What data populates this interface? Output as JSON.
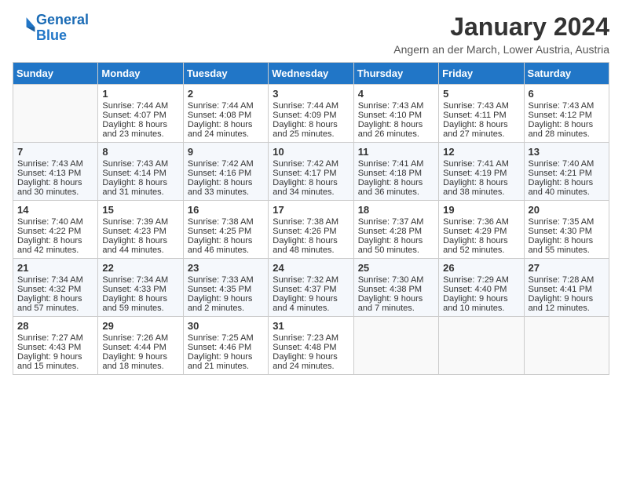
{
  "logo": {
    "line1": "General",
    "line2": "Blue"
  },
  "title": "January 2024",
  "subtitle": "Angern an der March, Lower Austria, Austria",
  "days_of_week": [
    "Sunday",
    "Monday",
    "Tuesday",
    "Wednesday",
    "Thursday",
    "Friday",
    "Saturday"
  ],
  "weeks": [
    [
      {
        "day": "",
        "sunrise": "",
        "sunset": "",
        "daylight": ""
      },
      {
        "day": "1",
        "sunrise": "Sunrise: 7:44 AM",
        "sunset": "Sunset: 4:07 PM",
        "daylight": "Daylight: 8 hours and 23 minutes."
      },
      {
        "day": "2",
        "sunrise": "Sunrise: 7:44 AM",
        "sunset": "Sunset: 4:08 PM",
        "daylight": "Daylight: 8 hours and 24 minutes."
      },
      {
        "day": "3",
        "sunrise": "Sunrise: 7:44 AM",
        "sunset": "Sunset: 4:09 PM",
        "daylight": "Daylight: 8 hours and 25 minutes."
      },
      {
        "day": "4",
        "sunrise": "Sunrise: 7:43 AM",
        "sunset": "Sunset: 4:10 PM",
        "daylight": "Daylight: 8 hours and 26 minutes."
      },
      {
        "day": "5",
        "sunrise": "Sunrise: 7:43 AM",
        "sunset": "Sunset: 4:11 PM",
        "daylight": "Daylight: 8 hours and 27 minutes."
      },
      {
        "day": "6",
        "sunrise": "Sunrise: 7:43 AM",
        "sunset": "Sunset: 4:12 PM",
        "daylight": "Daylight: 8 hours and 28 minutes."
      }
    ],
    [
      {
        "day": "7",
        "sunrise": "Sunrise: 7:43 AM",
        "sunset": "Sunset: 4:13 PM",
        "daylight": "Daylight: 8 hours and 30 minutes."
      },
      {
        "day": "8",
        "sunrise": "Sunrise: 7:43 AM",
        "sunset": "Sunset: 4:14 PM",
        "daylight": "Daylight: 8 hours and 31 minutes."
      },
      {
        "day": "9",
        "sunrise": "Sunrise: 7:42 AM",
        "sunset": "Sunset: 4:16 PM",
        "daylight": "Daylight: 8 hours and 33 minutes."
      },
      {
        "day": "10",
        "sunrise": "Sunrise: 7:42 AM",
        "sunset": "Sunset: 4:17 PM",
        "daylight": "Daylight: 8 hours and 34 minutes."
      },
      {
        "day": "11",
        "sunrise": "Sunrise: 7:41 AM",
        "sunset": "Sunset: 4:18 PM",
        "daylight": "Daylight: 8 hours and 36 minutes."
      },
      {
        "day": "12",
        "sunrise": "Sunrise: 7:41 AM",
        "sunset": "Sunset: 4:19 PM",
        "daylight": "Daylight: 8 hours and 38 minutes."
      },
      {
        "day": "13",
        "sunrise": "Sunrise: 7:40 AM",
        "sunset": "Sunset: 4:21 PM",
        "daylight": "Daylight: 8 hours and 40 minutes."
      }
    ],
    [
      {
        "day": "14",
        "sunrise": "Sunrise: 7:40 AM",
        "sunset": "Sunset: 4:22 PM",
        "daylight": "Daylight: 8 hours and 42 minutes."
      },
      {
        "day": "15",
        "sunrise": "Sunrise: 7:39 AM",
        "sunset": "Sunset: 4:23 PM",
        "daylight": "Daylight: 8 hours and 44 minutes."
      },
      {
        "day": "16",
        "sunrise": "Sunrise: 7:38 AM",
        "sunset": "Sunset: 4:25 PM",
        "daylight": "Daylight: 8 hours and 46 minutes."
      },
      {
        "day": "17",
        "sunrise": "Sunrise: 7:38 AM",
        "sunset": "Sunset: 4:26 PM",
        "daylight": "Daylight: 8 hours and 48 minutes."
      },
      {
        "day": "18",
        "sunrise": "Sunrise: 7:37 AM",
        "sunset": "Sunset: 4:28 PM",
        "daylight": "Daylight: 8 hours and 50 minutes."
      },
      {
        "day": "19",
        "sunrise": "Sunrise: 7:36 AM",
        "sunset": "Sunset: 4:29 PM",
        "daylight": "Daylight: 8 hours and 52 minutes."
      },
      {
        "day": "20",
        "sunrise": "Sunrise: 7:35 AM",
        "sunset": "Sunset: 4:30 PM",
        "daylight": "Daylight: 8 hours and 55 minutes."
      }
    ],
    [
      {
        "day": "21",
        "sunrise": "Sunrise: 7:34 AM",
        "sunset": "Sunset: 4:32 PM",
        "daylight": "Daylight: 8 hours and 57 minutes."
      },
      {
        "day": "22",
        "sunrise": "Sunrise: 7:34 AM",
        "sunset": "Sunset: 4:33 PM",
        "daylight": "Daylight: 8 hours and 59 minutes."
      },
      {
        "day": "23",
        "sunrise": "Sunrise: 7:33 AM",
        "sunset": "Sunset: 4:35 PM",
        "daylight": "Daylight: 9 hours and 2 minutes."
      },
      {
        "day": "24",
        "sunrise": "Sunrise: 7:32 AM",
        "sunset": "Sunset: 4:37 PM",
        "daylight": "Daylight: 9 hours and 4 minutes."
      },
      {
        "day": "25",
        "sunrise": "Sunrise: 7:30 AM",
        "sunset": "Sunset: 4:38 PM",
        "daylight": "Daylight: 9 hours and 7 minutes."
      },
      {
        "day": "26",
        "sunrise": "Sunrise: 7:29 AM",
        "sunset": "Sunset: 4:40 PM",
        "daylight": "Daylight: 9 hours and 10 minutes."
      },
      {
        "day": "27",
        "sunrise": "Sunrise: 7:28 AM",
        "sunset": "Sunset: 4:41 PM",
        "daylight": "Daylight: 9 hours and 12 minutes."
      }
    ],
    [
      {
        "day": "28",
        "sunrise": "Sunrise: 7:27 AM",
        "sunset": "Sunset: 4:43 PM",
        "daylight": "Daylight: 9 hours and 15 minutes."
      },
      {
        "day": "29",
        "sunrise": "Sunrise: 7:26 AM",
        "sunset": "Sunset: 4:44 PM",
        "daylight": "Daylight: 9 hours and 18 minutes."
      },
      {
        "day": "30",
        "sunrise": "Sunrise: 7:25 AM",
        "sunset": "Sunset: 4:46 PM",
        "daylight": "Daylight: 9 hours and 21 minutes."
      },
      {
        "day": "31",
        "sunrise": "Sunrise: 7:23 AM",
        "sunset": "Sunset: 4:48 PM",
        "daylight": "Daylight: 9 hours and 24 minutes."
      },
      {
        "day": "",
        "sunrise": "",
        "sunset": "",
        "daylight": ""
      },
      {
        "day": "",
        "sunrise": "",
        "sunset": "",
        "daylight": ""
      },
      {
        "day": "",
        "sunrise": "",
        "sunset": "",
        "daylight": ""
      }
    ]
  ]
}
